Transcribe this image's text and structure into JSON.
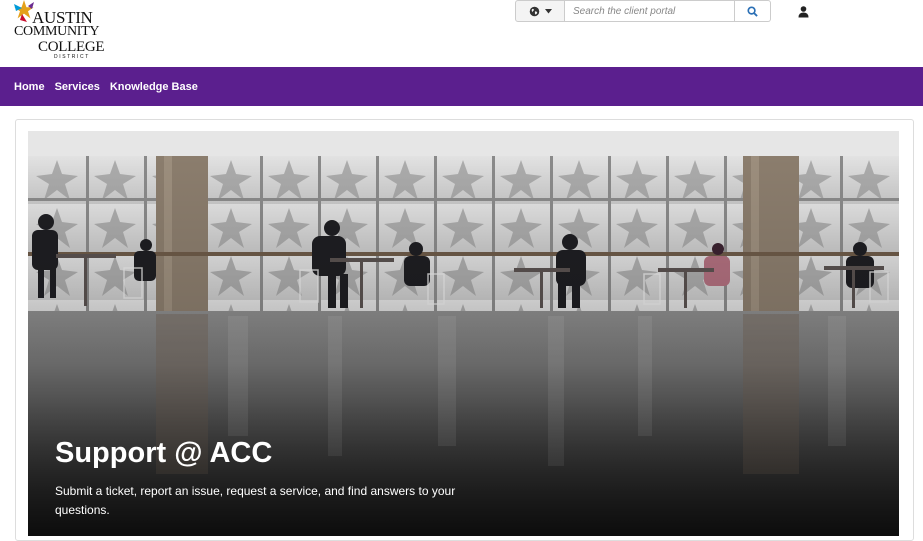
{
  "logo": {
    "line1": "AUSTIN",
    "line2": "COMMUNITY",
    "line3": "COLLEGE",
    "line4": "DISTRICT",
    "star_colors": [
      "#e4a11b",
      "#6a2c91",
      "#009ad9",
      "#c8102e"
    ]
  },
  "header": {
    "language_icon": "globe-icon",
    "search_placeholder": "Search the client portal",
    "search_icon": "search-icon",
    "user_icon": "user-icon"
  },
  "nav": {
    "items": [
      {
        "label": "Home"
      },
      {
        "label": "Services"
      },
      {
        "label": "Knowledge Base"
      }
    ],
    "bg_color": "#5b1f8e"
  },
  "hero": {
    "title": "Support @ ACC",
    "subtitle": "Submit a ticket, report an issue, request a service, and find answers to your questions."
  }
}
